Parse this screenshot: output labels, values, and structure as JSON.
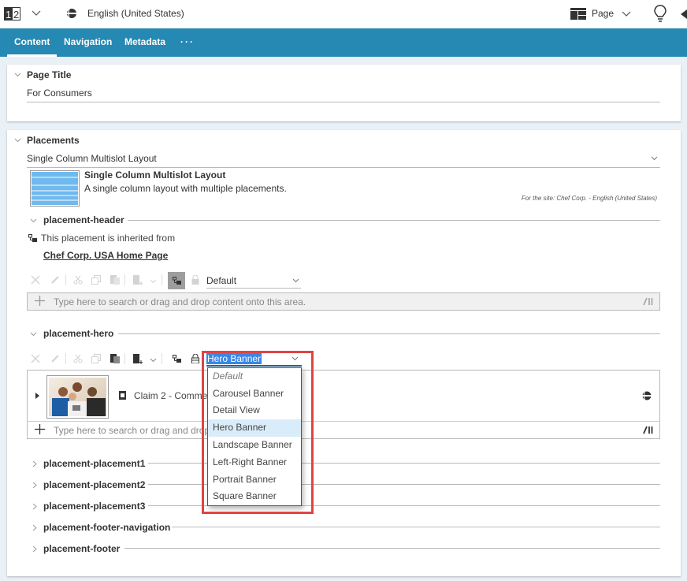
{
  "topbar": {
    "version_icon_text": "1|2",
    "language": "English (United States)",
    "view_label": "Page"
  },
  "tabs": [
    {
      "label": "Content",
      "active": true
    },
    {
      "label": "Navigation",
      "active": false
    },
    {
      "label": "Metadata",
      "active": false
    },
    {
      "label": "···",
      "active": false
    }
  ],
  "page_title": {
    "heading": "Page Title",
    "value": "For Consumers"
  },
  "placements": {
    "heading": "Placements",
    "layout_select": "Single Column Multislot Layout",
    "layout_name": "Single Column Multislot Layout",
    "layout_description": "A single column layout with multiple placements.",
    "layout_site": "For the site: Chef Corp. - English (United States)",
    "header": {
      "name": "placement-header",
      "inherited_text": "This placement is inherited from",
      "inherited_link": "Chef Corp. USA Home Page",
      "view_select": "Default",
      "drop_placeholder": "Type here to search or drag and drop content onto this area."
    },
    "hero": {
      "name": "placement-hero",
      "view_select": "Hero Banner",
      "item_title": "Claim 2 - Commer",
      "drop_placeholder": "Type here to search or drag and drop c",
      "dropdown_options": [
        {
          "label": "Default",
          "italic": true,
          "selected": false
        },
        {
          "label": "Carousel Banner",
          "selected": false
        },
        {
          "label": "Detail View",
          "selected": false
        },
        {
          "label": "Hero Banner",
          "selected": true
        },
        {
          "label": "Landscape Banner",
          "selected": false
        },
        {
          "label": "Left-Right Banner",
          "selected": false
        },
        {
          "label": "Portrait Banner",
          "selected": false
        },
        {
          "label": "Square Banner",
          "selected": false
        }
      ]
    },
    "collapsed": [
      "placement-placement1",
      "placement-placement2",
      "placement-placement3",
      "placement-footer-navigation",
      "placement-footer"
    ]
  },
  "colors": {
    "accent": "#2689b3",
    "highlight": "#e04444",
    "selection": "#3a86e8"
  }
}
